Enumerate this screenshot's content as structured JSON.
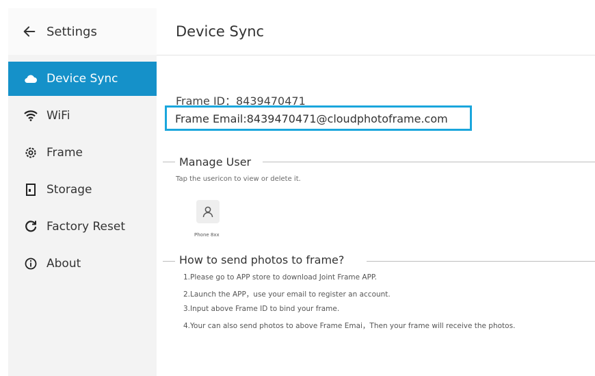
{
  "sidebar": {
    "back_label": "Settings",
    "items": [
      {
        "label": "Device Sync",
        "icon": "cloud-icon",
        "active": true
      },
      {
        "label": "WiFi",
        "icon": "wifi-icon",
        "active": false
      },
      {
        "label": "Frame",
        "icon": "gear-icon",
        "active": false
      },
      {
        "label": "Storage",
        "icon": "storage-icon",
        "active": false
      },
      {
        "label": "Factory Reset",
        "icon": "reset-icon",
        "active": false
      },
      {
        "label": "About",
        "icon": "info-icon",
        "active": false
      }
    ]
  },
  "header": {
    "title": "Device Sync"
  },
  "frame_info": {
    "id_text": "Frame ID：8439470471",
    "email_text": "Frame Email:8439470471@cloudphotoframe.com"
  },
  "manage_user": {
    "title": "Manage User",
    "hint": "Tap the usericon to view or delete it.",
    "users": [
      {
        "name": "Phone 8xx",
        "icon": "user-icon"
      }
    ]
  },
  "how_to": {
    "title": "How to send photos to frame?",
    "steps": [
      "1.Please go to APP store to download Joint Frame APP.",
      "2.Launch the APP，use your email to register an account.",
      "3.Input above Frame ID to bind your frame.",
      "4.Your can also send photos to above Frame Emai，Then your frame will receive the photos."
    ]
  },
  "colors": {
    "accent": "#1591c9",
    "highlight_border": "#1aa6dc",
    "sidebar_bg": "#f3f3f3"
  }
}
